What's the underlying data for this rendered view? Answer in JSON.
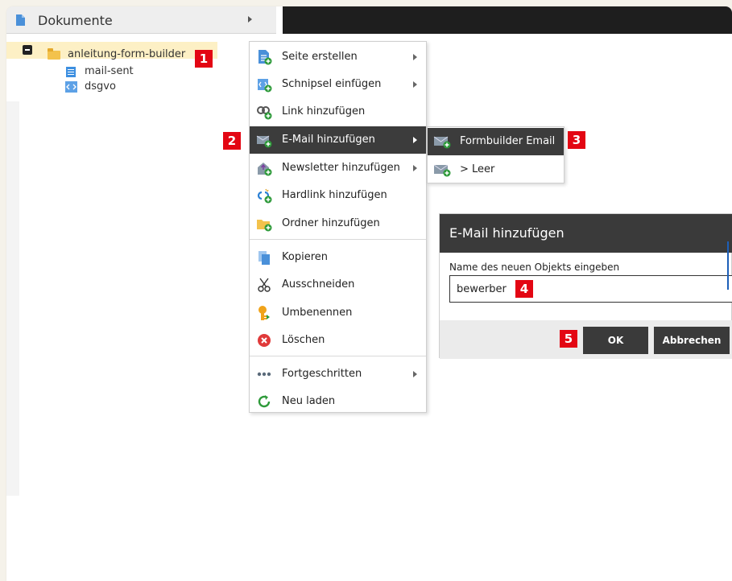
{
  "colors": {
    "accent_badge": "#e30613",
    "selected_row": "#fdf0c5",
    "menu_active": "#3c3c3c",
    "dialog_header": "#3a3a3a"
  },
  "tree": {
    "header_title": "Dokumente",
    "root": {
      "label": "anleitung-form-builder",
      "icon": "folder-icon"
    },
    "children": [
      {
        "label": "mail-sent",
        "icon": "document-icon"
      },
      {
        "label": "dsgvo",
        "icon": "snippet-icon"
      }
    ]
  },
  "badges": {
    "b1": "1",
    "b2": "2",
    "b3": "3",
    "b4": "4",
    "b5": "5"
  },
  "context_menu": {
    "items": [
      {
        "label": "Seite erstellen",
        "icon": "page-add-icon",
        "has_submenu": true
      },
      {
        "label": "Schnipsel einfügen",
        "icon": "snippet-add-icon",
        "has_submenu": true
      },
      {
        "label": "Link hinzufügen",
        "icon": "link-add-icon",
        "has_submenu": false
      },
      {
        "label": "E-Mail hinzufügen",
        "icon": "email-add-icon",
        "has_submenu": true,
        "active": true
      },
      {
        "label": "Newsletter hinzufügen",
        "icon": "newsletter-add-icon",
        "has_submenu": true
      },
      {
        "label": "Hardlink hinzufügen",
        "icon": "hardlink-add-icon",
        "has_submenu": false
      },
      {
        "label": "Ordner hinzufügen",
        "icon": "folder-add-icon",
        "has_submenu": false
      },
      {
        "label": "Kopieren",
        "icon": "copy-icon",
        "has_submenu": false
      },
      {
        "label": "Ausschneiden",
        "icon": "cut-icon",
        "has_submenu": false
      },
      {
        "label": "Umbenennen",
        "icon": "rename-key-icon",
        "has_submenu": false
      },
      {
        "label": "Löschen",
        "icon": "delete-icon",
        "has_submenu": false
      },
      {
        "label": "Fortgeschritten",
        "icon": "more-dots-icon",
        "has_submenu": true
      },
      {
        "label": "Neu laden",
        "icon": "reload-icon",
        "has_submenu": false
      }
    ]
  },
  "email_submenu": {
    "items": [
      {
        "label": "Formbuilder Email",
        "icon": "email-add-icon",
        "active": true
      },
      {
        "label": "> Leer",
        "icon": "email-add-icon",
        "active": false
      }
    ]
  },
  "dialog": {
    "title": "E-Mail hinzufügen",
    "field_label": "Name des neuen Objekts eingeben",
    "field_value": "bewerber",
    "ok_label": "OK",
    "cancel_label": "Abbrechen"
  }
}
